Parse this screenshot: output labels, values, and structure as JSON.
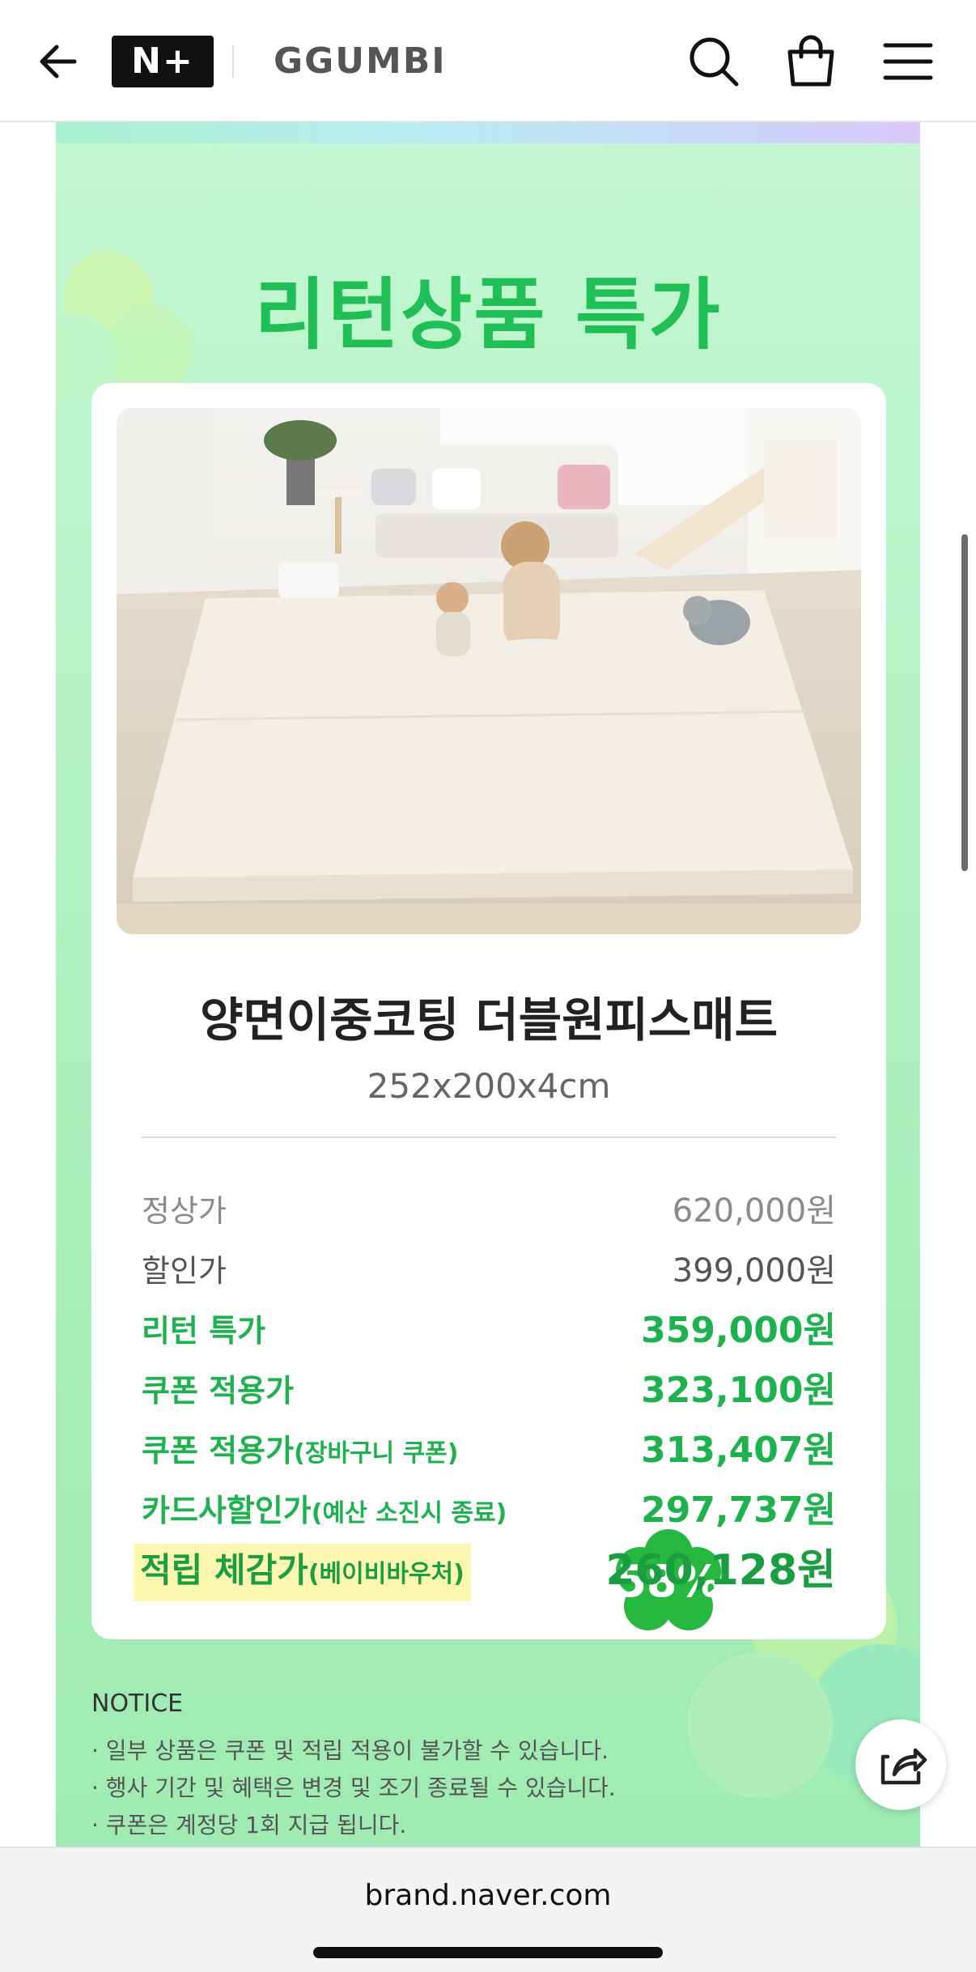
{
  "header": {
    "brand_badge": "N+",
    "brand_name": "GGUMBI",
    "icons": [
      "back-arrow-icon",
      "search-icon",
      "shopping-bag-icon",
      "hamburger-menu-icon"
    ]
  },
  "promo": {
    "headline": "리턴상품 특가",
    "product_name": "양면이중코팅 더블원피스매트",
    "product_size": "252x200x4cm",
    "prices": [
      {
        "label": "정상가",
        "sub": "",
        "value": "620,000원"
      },
      {
        "label": "할인가",
        "sub": "",
        "value": "399,000원"
      },
      {
        "label": "리턴 특가",
        "sub": "",
        "value": "359,000원"
      },
      {
        "label": "쿠폰 적용가",
        "sub": "",
        "value": "323,100원"
      },
      {
        "label": "쿠폰 적용가",
        "sub": "(장바구니 쿠폰)",
        "value": "313,407원"
      },
      {
        "label": "카드사할인가",
        "sub": "(예산 소진시 종료)",
        "value": "297,737원"
      },
      {
        "label": "적립 체감가",
        "sub": "(베이비바우처)",
        "value": "260,128원"
      }
    ],
    "discount_badge": "58%"
  },
  "notice": {
    "title": "NOTICE",
    "items": [
      "· 일부 상품은 쿠폰 및 적립 적용이 불가할 수 있습니다.",
      "· 행사 기간 및 혜택은 변경 및 조기 종료될 수 있습니다.",
      "· 쿠폰은 계정당 1회 지급 됩니다."
    ]
  },
  "browser": {
    "url": "brand.naver.com"
  },
  "colors": {
    "accent_green": "#1db24d",
    "background_mint": "#b6f3c7",
    "highlight_yellow": "#fef7b0"
  }
}
